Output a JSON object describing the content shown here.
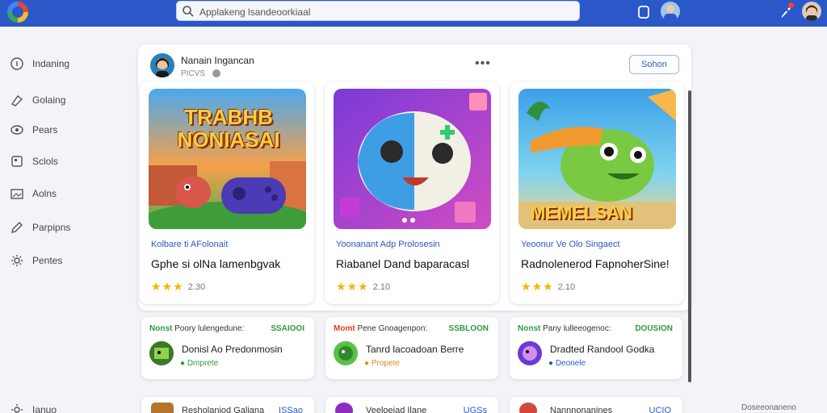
{
  "search": {
    "placeholder": "Applakeng lsandeoorkiaal"
  },
  "sidebar": {
    "items": [
      {
        "label": "Indaning",
        "icon": "circle-info-icon"
      },
      {
        "label": "Golaing",
        "icon": "tag-icon"
      },
      {
        "label": "Pears",
        "icon": "eye-icon"
      },
      {
        "label": "Sclols",
        "icon": "square-icon"
      },
      {
        "label": "Aolns",
        "icon": "image-icon"
      },
      {
        "label": "Parpipns",
        "icon": "pencil-icon"
      },
      {
        "label": "Pentes",
        "icon": "gear-icon"
      },
      {
        "label": "Ianuo",
        "icon": "gear-icon"
      }
    ]
  },
  "post": {
    "author": "Nanain Ingancan",
    "author_sub": "PICVS",
    "more": "•••",
    "follow_label": "Sohon"
  },
  "games": [
    {
      "banner": "TRABHB NONIASAI",
      "category": "Kolbare ti AFolonait",
      "title": "Gphe si olNa lamenbgvak",
      "rating": "2.30",
      "stars": 2.5
    },
    {
      "banner": "",
      "category": "Yoonanant Adp Prolosesin",
      "title": "Riabanel Dand baparacasl",
      "rating": "2.10",
      "stars": 2.5
    },
    {
      "banner": "MEMELSAN",
      "category": "Yeoonur Ve Olo Singaect",
      "title": "Radnolenerod FapnoherSine!",
      "rating": "2.10",
      "stars": 2.5
    }
  ],
  "mini": [
    {
      "tag": "Nonst",
      "desc": "Poory lulengedune:",
      "price": "SSAIOOI",
      "title": "Donisl Ao Predonmosin",
      "sub": "Dmprete",
      "sub_color": "#2e9b3d"
    },
    {
      "tag": "Momt",
      "desc": "Pene Gnoagenpon:",
      "price": "SSBLOON",
      "title": "Tanrd lacoadoan Berre",
      "sub": "Propete",
      "sub_color": "#e08a1e"
    },
    {
      "tag": "Nonst",
      "desc": "Pany lulleeogenoc:",
      "price": "DOUSION",
      "title": "Dradted Randool Godka",
      "sub": "Deonele",
      "sub_color": "#2a58c8"
    }
  ],
  "bottom": [
    {
      "title": "Resholaniod Galiana",
      "right": "ISSao"
    },
    {
      "title": "Veeloeiad Ilane",
      "right": "UGSs"
    },
    {
      "title": "Nannnonanines",
      "right": "UCIO"
    }
  ],
  "footer": "Doseeonaneno"
}
